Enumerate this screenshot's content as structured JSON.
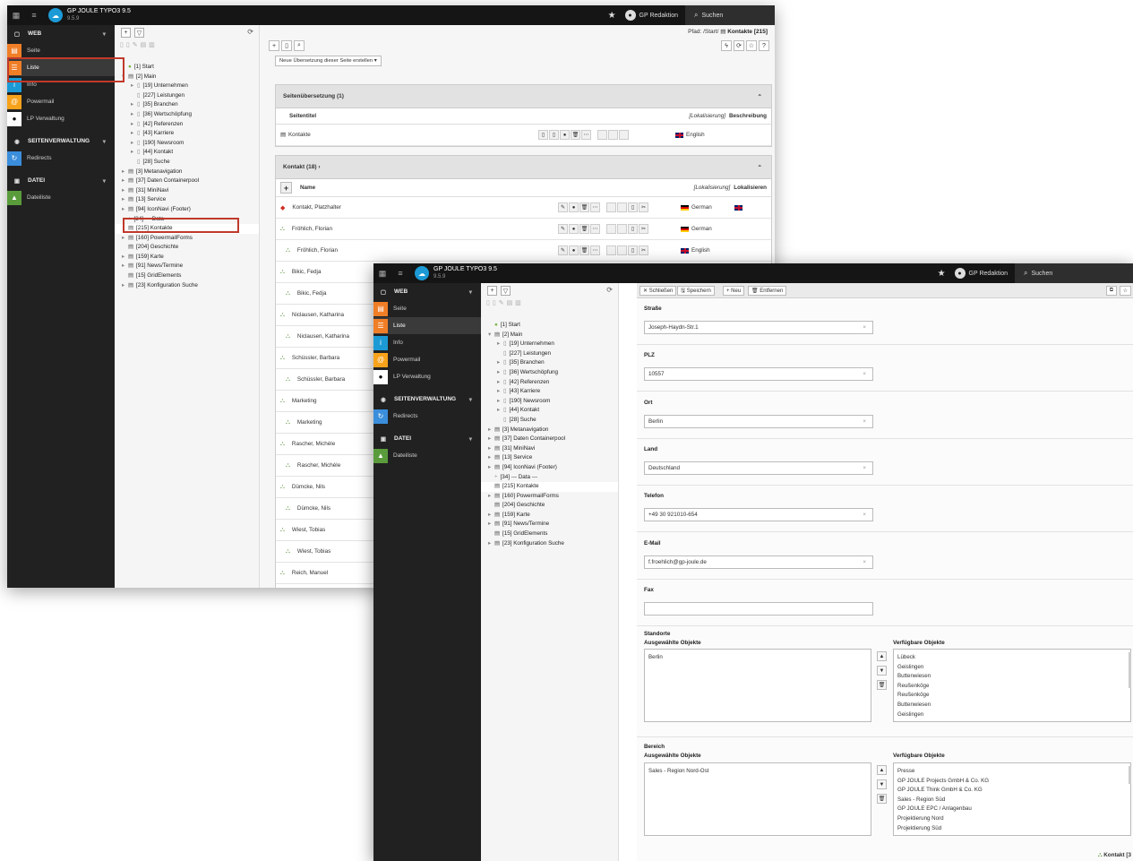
{
  "app": {
    "title": "GP JOULE TYPO3 9.5",
    "version": "9.5.9"
  },
  "topbar": {
    "user": "GP Redaktion",
    "search": "Suchen"
  },
  "menu": {
    "groups": [
      {
        "label": "WEB",
        "items": [
          "Seite",
          "Liste",
          "Info",
          "Powermail",
          "LP Verwaltung"
        ]
      },
      {
        "label": "SEITENVERWALTUNG",
        "items": [
          "Redirects"
        ]
      },
      {
        "label": "DATEI",
        "items": [
          "Dateiliste"
        ]
      }
    ],
    "colors": {
      "seite": "#f07e27",
      "liste": "#f07e27",
      "info": "#1b9ad6",
      "powermail": "#f7a21b",
      "lp": "#ffffff",
      "redirects": "#3a8edb",
      "dateiliste": "#5a9c3c"
    }
  },
  "tree": [
    {
      "t": "[1] Start",
      "l": 0,
      "i": "globe"
    },
    {
      "t": "[2] Main",
      "l": 0,
      "i": "folder",
      "open": true
    },
    {
      "t": "[19] Unternehmen",
      "l": 1,
      "i": "page",
      "x": true
    },
    {
      "t": "[227] Leistungen",
      "l": 1,
      "i": "page"
    },
    {
      "t": "[35] Branchen",
      "l": 1,
      "i": "page",
      "x": true
    },
    {
      "t": "[36] Wertschöpfung",
      "l": 1,
      "i": "page",
      "x": true
    },
    {
      "t": "[42] Referenzen",
      "l": 1,
      "i": "page",
      "x": true
    },
    {
      "t": "[43] Karriere",
      "l": 1,
      "i": "page",
      "x": true
    },
    {
      "t": "[190] Newsroom",
      "l": 1,
      "i": "page",
      "x": true
    },
    {
      "t": "[44] Kontakt",
      "l": 1,
      "i": "page",
      "x": true
    },
    {
      "t": "[28] Suche",
      "l": 1,
      "i": "page"
    },
    {
      "t": "[3] Metanavigation",
      "l": 0,
      "i": "folder",
      "x": true
    },
    {
      "t": "[37] Daten Containerpool",
      "l": 0,
      "i": "folder",
      "x": true
    },
    {
      "t": "[31] MiniNavi",
      "l": 0,
      "i": "folder",
      "x": true
    },
    {
      "t": "[13] Service",
      "l": 0,
      "i": "folder",
      "x": true
    },
    {
      "t": "[94] IconNavi (Footer)",
      "l": 0,
      "i": "folder",
      "x": true
    },
    {
      "t": "[34] --- Data ---",
      "l": 0,
      "i": "sep"
    },
    {
      "t": "[215] Kontakte",
      "l": 0,
      "i": "folder",
      "sel": true
    },
    {
      "t": "[160] PowermailForms",
      "l": 0,
      "i": "folder",
      "x": true
    },
    {
      "t": "[204] Geschichte",
      "l": 0,
      "i": "folder"
    },
    {
      "t": "[159] Karte",
      "l": 0,
      "i": "folder",
      "x": true
    },
    {
      "t": "[91] News/Termine",
      "l": 0,
      "i": "folder",
      "x": true
    },
    {
      "t": "[15] GridElements",
      "l": 0,
      "i": "folder"
    },
    {
      "t": "[23] Konfiguration Suche",
      "l": 0,
      "i": "folder",
      "x": true
    }
  ],
  "list": {
    "path_label": "Pfad: /Start/",
    "path_page": "Kontakte [215]",
    "translate_select": "Neue Übersetzung dieser Seite erstellen",
    "trans_panel": {
      "title": "Seitenübersetzung (1)",
      "col_title": "Seitentitel",
      "col_loc": "[Lokalisierung]",
      "col_desc": "Beschreibung",
      "row": "Kontakte",
      "lang": "English"
    },
    "contacts_panel": {
      "title": "Kontakt (18)",
      "col_name": "Name",
      "col_loc": "[Lokalisierung]",
      "col_locall": "Lokalisieren",
      "rows": [
        {
          "name": "Kontakt, Platzhalter",
          "lang": "German",
          "flag": "de",
          "red": true,
          "uk": true,
          "indent": false
        },
        {
          "name": "Fröhlich, Florian",
          "lang": "German",
          "flag": "de",
          "indent": false
        },
        {
          "name": "Fröhlich, Florian",
          "lang": "English",
          "flag": "en",
          "indent": true
        },
        {
          "name": "Bikic, Fedja",
          "indent": false
        },
        {
          "name": "Bikic, Fedja",
          "indent": true
        },
        {
          "name": "Niclausen, Katharina",
          "indent": false
        },
        {
          "name": "Niclausen, Katharina",
          "indent": true
        },
        {
          "name": "Schüssler, Barbara",
          "indent": false
        },
        {
          "name": "Schüssler, Barbara",
          "indent": true
        },
        {
          "name": "Marketing",
          "indent": false
        },
        {
          "name": "Marketing",
          "indent": true
        },
        {
          "name": "Rascher, Michèle",
          "indent": false
        },
        {
          "name": "Rascher, Michèle",
          "indent": true
        },
        {
          "name": "Dümcke, Nils",
          "indent": false
        },
        {
          "name": "Dümcke, Nils",
          "indent": true
        },
        {
          "name": "Wiest, Tobias",
          "indent": false
        },
        {
          "name": "Wiest, Tobias",
          "indent": true
        },
        {
          "name": "Reich, Manuel",
          "indent": false
        }
      ]
    }
  },
  "editor": {
    "buttons": {
      "close": "Schließen",
      "save": "Speichern",
      "new": "Neu",
      "remove": "Entfernen"
    },
    "fields": [
      {
        "label": "Straße",
        "value": "Joseph-Haydn-Str.1"
      },
      {
        "label": "PLZ",
        "value": "10557"
      },
      {
        "label": "Ort",
        "value": "Berlin"
      },
      {
        "label": "Land",
        "value": "Deutschland"
      },
      {
        "label": "Telefon",
        "value": "+49 30 921010-654"
      },
      {
        "label": "E-Mail",
        "value": "f.froehlich@gp-joule.de"
      },
      {
        "label": "Fax",
        "value": ""
      }
    ],
    "standorte": {
      "label": "Standorte",
      "selected_label": "Ausgewählte Objekte",
      "available_label": "Verfügbare Objekte",
      "selected": [
        "Berlin"
      ],
      "available": [
        "Lübeck",
        "Geislingen",
        "Buttenwiesen",
        "Reußenköge",
        "Reußenköge",
        "Buttenwiesen",
        "Geislingen"
      ]
    },
    "bereich": {
      "label": "Bereich",
      "selected_label": "Ausgewählte Objekte",
      "available_label": "Verfügbare Objekte",
      "selected": [
        "Sales - Region Nord-Ost"
      ],
      "available": [
        "Presse",
        "GP JOULE Projects GmbH & Co. KG",
        "GP JOULE Think GmbH & Co. KG",
        "Sales - Region Süd",
        "GP JOULE EPC / Anlagenbau",
        "Projektierung Nord",
        "Projektierung Süd"
      ]
    },
    "footer": "Kontakt [3"
  }
}
